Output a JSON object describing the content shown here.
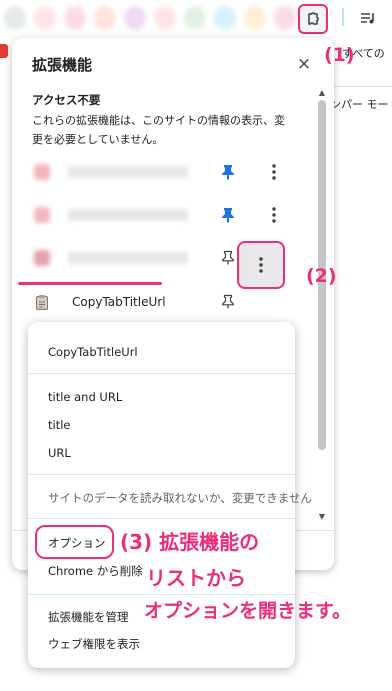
{
  "annotations": {
    "step1": "(1)",
    "step2": "(2)",
    "step3_line1": "(3) 拡張機能の",
    "step3_line2": "リストから",
    "step3_line3": "オプションを開きます。"
  },
  "background": {
    "text_top": "すべての",
    "text_mid": "ンパー モー"
  },
  "panel": {
    "title": "拡張機能",
    "close_symbol": "×",
    "section_title": "アクセス不要",
    "section_desc": "これらの拡張機能は、このサイトの情報の表示、変更を必要としていません。",
    "extension_name": "CopyTabTitleUrl"
  },
  "context_menu": {
    "header": "CopyTabTitleUrl",
    "copy_title_and_url": "title and URL",
    "copy_title": "title",
    "copy_url": "URL",
    "site_access_note": "サイトのデータを読み取れないか、変更できません",
    "options": "オプション",
    "remove": "Chrome から削除",
    "manage": "拡張機能を管理",
    "view_permissions": "ウェブ権限を表示"
  },
  "colors": {
    "annotation_pink": "#ec2d7c",
    "pin_blue": "#1a73e8"
  }
}
